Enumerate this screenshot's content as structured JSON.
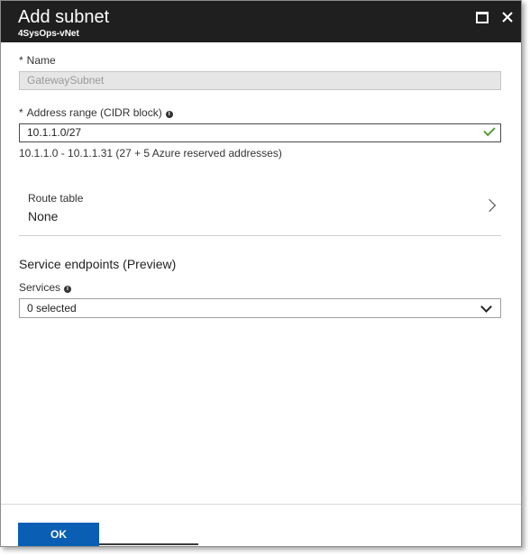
{
  "header": {
    "title": "Add subnet",
    "subtitle": "4SysOps-vNet"
  },
  "name_field": {
    "required_mark": "*",
    "label": "Name",
    "value": "GatewaySubnet"
  },
  "address_field": {
    "required_mark": "*",
    "label": "Address range (CIDR block)",
    "value": "10.1.1.0/27",
    "helper": "10.1.1.0 - 10.1.1.31 (27 + 5 Azure reserved addresses)"
  },
  "route_table": {
    "label": "Route table",
    "value": "None"
  },
  "service_endpoints": {
    "title": "Service endpoints (Preview)",
    "services_label": "Services",
    "services_value": "0 selected"
  },
  "footer": {
    "ok_label": "OK"
  },
  "icons": {
    "maximize": "maximize-icon",
    "close": "close-icon",
    "info": "info-icon",
    "check": "check-icon",
    "chevron_right": "chevron-right-icon",
    "chevron_down": "chevron-down-icon"
  },
  "colors": {
    "header_bg": "#1f1f1f",
    "primary_button": "#0a5fb4",
    "valid_check": "#5a9c3c"
  }
}
